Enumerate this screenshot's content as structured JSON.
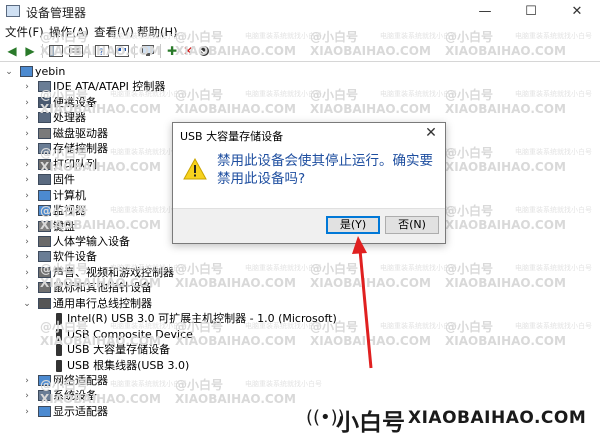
{
  "window": {
    "title": "设备管理器",
    "controls": {
      "minimize": "—",
      "maximize": "☐",
      "close": "✕"
    }
  },
  "menu": {
    "items": [
      "文件(F)",
      "操作(A)",
      "查看(V)",
      "帮助(H)"
    ]
  },
  "tree": {
    "root": "yebin",
    "categories": [
      {
        "label": "IDE ATA/ATAPI 控制器",
        "icon": "ide-controller-icon"
      },
      {
        "label": "便携设备",
        "icon": "portable-device-icon"
      },
      {
        "label": "处理器",
        "icon": "processor-icon"
      },
      {
        "label": "磁盘驱动器",
        "icon": "disk-drive-icon"
      },
      {
        "label": "存储控制器",
        "icon": "storage-controller-icon"
      },
      {
        "label": "打印队列",
        "icon": "printer-icon"
      },
      {
        "label": "固件",
        "icon": "firmware-icon"
      },
      {
        "label": "计算机",
        "icon": "computer-icon"
      },
      {
        "label": "监视器",
        "icon": "monitor-icon"
      },
      {
        "label": "键盘",
        "icon": "keyboard-icon"
      },
      {
        "label": "人体学输入设备",
        "icon": "hid-icon"
      },
      {
        "label": "软件设备",
        "icon": "software-device-icon"
      },
      {
        "label": "声音、视频和游戏控制器",
        "icon": "sound-icon"
      },
      {
        "label": "鼠标和其他指针设备",
        "icon": "mouse-icon"
      },
      {
        "label": "通用串行总线控制器",
        "icon": "usb-controller-icon",
        "expanded": true
      }
    ],
    "usb_children": [
      "Intel(R) USB 3.0 可扩展主机控制器 - 1.0 (Microsoft)",
      "USB Composite Device",
      "USB 大容量存储设备",
      "USB 根集线器(USB 3.0)"
    ],
    "tail_categories": [
      {
        "label": "网络适配器",
        "icon": "network-icon"
      },
      {
        "label": "系统设备",
        "icon": "system-device-icon"
      },
      {
        "label": "显示适配器",
        "icon": "display-adapter-icon"
      }
    ]
  },
  "dialog": {
    "title": "USB 大容量存储设备",
    "message": "禁用此设备会使其停止运行。确实要禁用此设备吗?",
    "yes_label": "是(Y)",
    "no_label": "否(N)",
    "close": "✕"
  },
  "watermark": {
    "name": "@小白号",
    "domain": "XIAOBAIHAO.COM",
    "tagline": "电脑重装系统就找小白号"
  },
  "brand": {
    "name": "小白号",
    "domain": "XIAOBAIHAO.COM"
  },
  "colors": {
    "accent": "#0078d7",
    "message_text": "#1f4fa0",
    "arrow": "#e02020"
  }
}
